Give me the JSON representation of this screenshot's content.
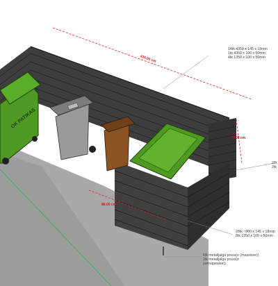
{
  "dimensions": {
    "top_width": "435.00 cm",
    "right_depth": "79.00 cm",
    "front_depth": "86.00 cm"
  },
  "notes": {
    "top_list": [
      "14tk  4350 x 145 x 18mm",
      "1tk    4350 x 100 x 50mm",
      "4tk    1350 x 100 x 50mm"
    ],
    "right_partial": [
      "28t",
      "2tk"
    ],
    "front_list": [
      "28tk ~900 x 145 x 18mm",
      "8tk 1350 x 100 x 50mm"
    ],
    "bottom_list": [
      "6tk metalljalga pruss(e (maasisse))",
      "2tk metalljalga pruss(e",
      "(seinäpealse))"
    ]
  },
  "bin_label": "OK PATIKAS",
  "colors": {
    "ground": "#a9a9a9",
    "fence": "#3d3d3d",
    "bin_green": "#4f9a22",
    "bin_grey": "#9a9a9a",
    "bin_brown": "#8a5324",
    "dimension_red": "#e02020"
  }
}
